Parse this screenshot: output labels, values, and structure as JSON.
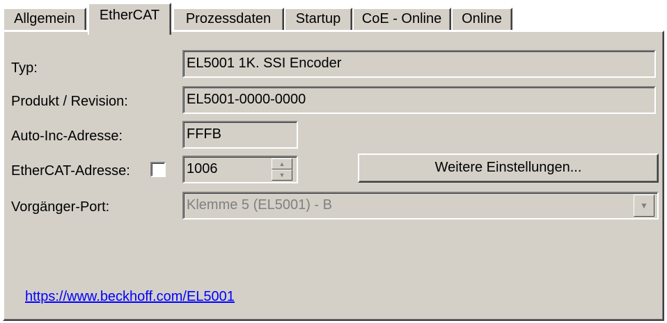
{
  "tabs": [
    {
      "label": "Allgemein",
      "active": false
    },
    {
      "label": "EtherCAT",
      "active": true
    },
    {
      "label": "Prozessdaten",
      "active": false
    },
    {
      "label": "Startup",
      "active": false
    },
    {
      "label": "CoE - Online",
      "active": false
    },
    {
      "label": "Online",
      "active": false
    }
  ],
  "fields": {
    "typ": {
      "label": "Typ:",
      "value": "EL5001 1K. SSI Encoder"
    },
    "produkt_revision": {
      "label": "Produkt / Revision:",
      "value": "EL5001-0000-0000"
    },
    "auto_inc_adresse": {
      "label": "Auto-Inc-Adresse:",
      "value": "FFFB"
    },
    "ethercat_adresse": {
      "label": "EtherCAT-Adresse:",
      "value": "1006",
      "checked": false
    },
    "vorgaenger_port": {
      "label": "Vorgänger-Port:",
      "value": "Klemme 5 (EL5001) - B"
    }
  },
  "buttons": {
    "weitere_einstellungen": "Weitere Einstellungen..."
  },
  "link": {
    "text": "https://www.beckhoff.com/EL5001"
  },
  "colors": {
    "face": "#d4d0c8",
    "link": "#0000ff",
    "disabled_text": "#808080"
  }
}
